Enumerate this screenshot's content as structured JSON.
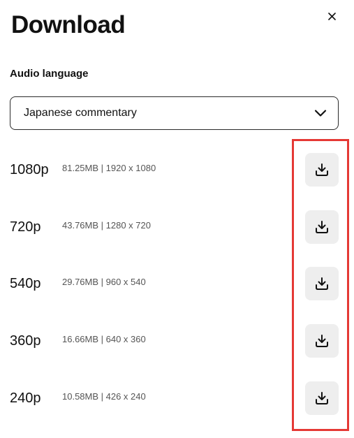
{
  "dialog": {
    "title": "Download",
    "close_icon": "close-icon"
  },
  "audio": {
    "label": "Audio language",
    "selected": "Japanese commentary",
    "dropdown_icon": "chevron-down-icon"
  },
  "options": [
    {
      "resolution": "1080p",
      "info": "81.25MB | 1920 x 1080"
    },
    {
      "resolution": "720p",
      "info": "43.76MB | 1280 x 720"
    },
    {
      "resolution": "540p",
      "info": "29.76MB | 960 x 540"
    },
    {
      "resolution": "360p",
      "info": "16.66MB | 640 x 360"
    },
    {
      "resolution": "240p",
      "info": "10.58MB | 426 x 240"
    }
  ],
  "icons": {
    "download": "download-icon"
  },
  "colors": {
    "highlight": "#e53935",
    "button_bg": "#eeeeee",
    "text": "#111111",
    "muted": "#555555"
  }
}
